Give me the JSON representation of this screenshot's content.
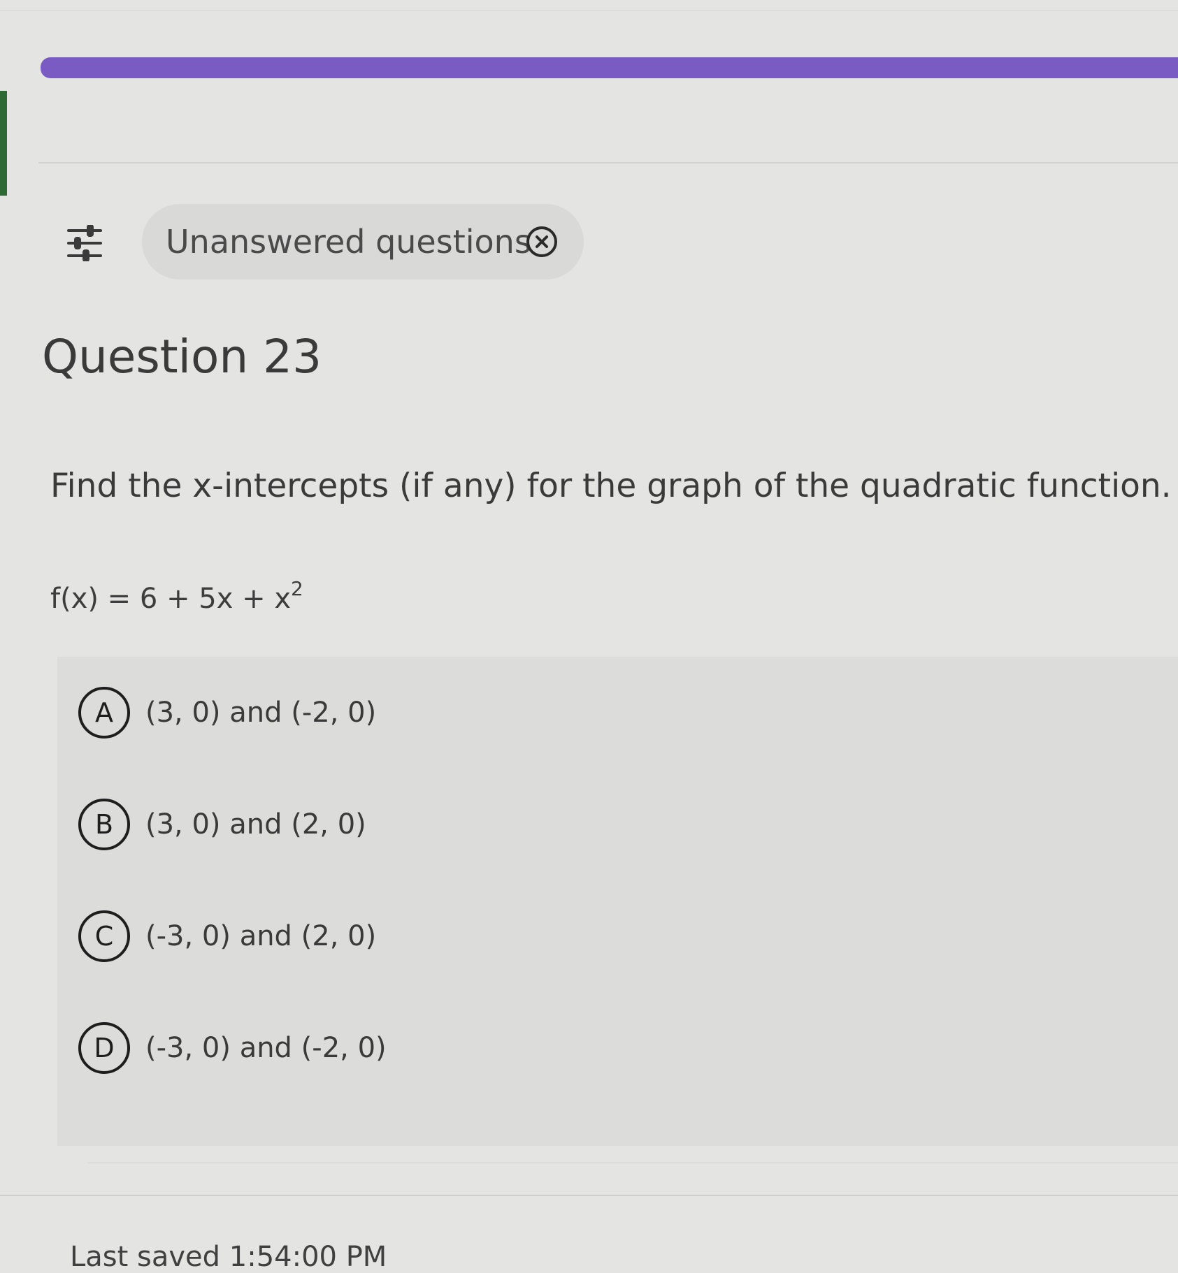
{
  "filter": {
    "icon": "filter-sliders-icon",
    "chip_label": "Unanswered questions",
    "chip_close_icon": "close-circle-icon"
  },
  "question": {
    "title": "Question 23",
    "prompt": "Find the x-intercepts (if any) for the graph of the quadratic function.",
    "equation_main": "f(x) = 6 + 5x + x",
    "equation_exponent": "2"
  },
  "options": [
    {
      "letter": "A",
      "text": "(3, 0) and (-2, 0)"
    },
    {
      "letter": "B",
      "text": "(3, 0) and (2, 0)"
    },
    {
      "letter": "C",
      "text": "(-3, 0) and (2, 0)"
    },
    {
      "letter": "D",
      "text": "(-3, 0) and (-2, 0)"
    }
  ],
  "footer": {
    "last_saved": "Last saved 1:54:00 PM"
  },
  "colors": {
    "progress": "#7a5bc4",
    "background": "#e4e4e2"
  }
}
